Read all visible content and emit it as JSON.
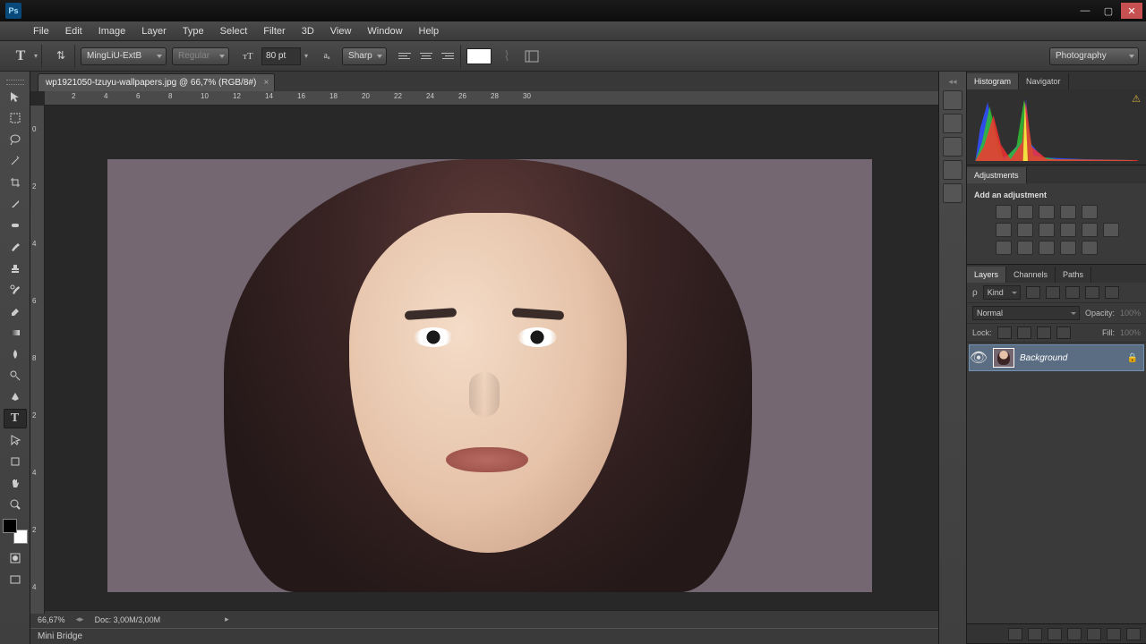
{
  "menu": [
    "File",
    "Edit",
    "Image",
    "Layer",
    "Type",
    "Select",
    "Filter",
    "3D",
    "View",
    "Window",
    "Help"
  ],
  "options": {
    "font_family": "MingLiU-ExtB",
    "font_style": "Regular",
    "font_size": "80 pt",
    "aa": "Sharp",
    "workspace": "Photography"
  },
  "doc": {
    "tab": "wp1921050-tzuyu-wallpapers.jpg @ 66,7% (RGB/8#)",
    "zoom": "66,67%",
    "docinfo": "Doc: 3,00M/3,00M"
  },
  "bottom_tab": "Mini Bridge",
  "ruler_h": [
    "2",
    "4",
    "6",
    "8",
    "10",
    "12",
    "14",
    "16",
    "18",
    "20",
    "22",
    "24",
    "26",
    "28",
    "30"
  ],
  "ruler_v": [
    "0",
    "2",
    "4",
    "6",
    "8",
    "2",
    "4",
    "2",
    "4"
  ],
  "panel_tabs": {
    "histogram": [
      "Histogram",
      "Navigator"
    ],
    "adjustments": "Adjustments",
    "adj_label": "Add an adjustment",
    "layers": [
      "Layers",
      "Channels",
      "Paths"
    ]
  },
  "layers": {
    "filter": "Kind",
    "blend": "Normal",
    "opacity_lbl": "Opacity:",
    "opacity": "100%",
    "fill_lbl": "Fill:",
    "fill": "100%",
    "lock_lbl": "Lock:",
    "items": [
      {
        "name": "Background"
      }
    ]
  }
}
